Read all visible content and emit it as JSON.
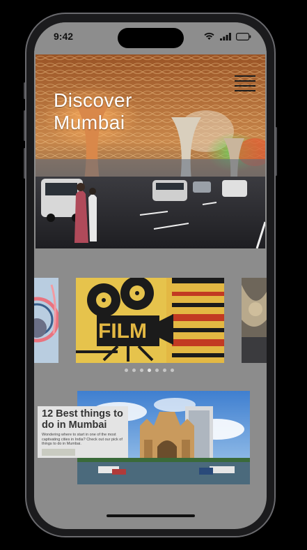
{
  "status_bar": {
    "time": "9:42",
    "icons": [
      "wifi-icon",
      "cellular-signal-icon",
      "battery-icon"
    ]
  },
  "hero": {
    "title_line1": "Discover",
    "title_line2": "Mumbai",
    "menu_icon": "hamburger-menu-icon"
  },
  "carousel": {
    "slides": [
      {
        "name": "music-headphones-slide"
      },
      {
        "name": "film-slide",
        "text": "FILM"
      },
      {
        "name": "airport-slide"
      }
    ],
    "dot_count": 7,
    "active_dot": 4
  },
  "article": {
    "title": "12 Best things to do in Mumbai",
    "description": "Wondering where to start in one of the most captivating cities in India? Check out our pick of things to do in Mumbai.",
    "button_label": ""
  },
  "colors": {
    "screen_bg": "#8c8c8c",
    "film_yellow": "#e6c34c",
    "film_red": "#c23a22",
    "card_bg": "#e4e4e4"
  }
}
